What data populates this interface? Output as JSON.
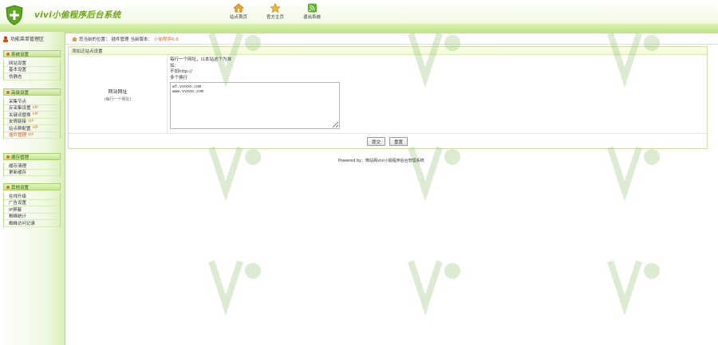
{
  "header": {
    "title": "vivi小偷程序后台系统",
    "nav": [
      {
        "label": "站点首页",
        "icon": "home-icon"
      },
      {
        "label": "官方主页",
        "icon": "star-icon"
      },
      {
        "label": "退出系统",
        "icon": "rss-icon"
      }
    ]
  },
  "sidebar": {
    "heading": "功能菜单管理区",
    "groups": [
      {
        "title": "系统设置",
        "items": [
          "网站设置",
          "基本设置",
          "伪静态"
        ]
      },
      {
        "title": "高级设置",
        "items": [
          "采集节点",
          "反采集设置",
          "关键词替换",
          "友情链接",
          "站点群配置",
          "插件管理"
        ]
      },
      {
        "title": "缓存管理",
        "items": [
          "缓存清理",
          "更新缓存"
        ]
      },
      {
        "title": "其他设置",
        "items": [
          "在线升级",
          "广告设置",
          "IP屏蔽",
          "蜘蛛统计",
          "蜘蛛访问记录"
        ]
      }
    ],
    "vip_badge": "VIP"
  },
  "breadcrumb": {
    "prefix": "您当前的位置：",
    "section": "插件管理",
    "label": "当前版本：",
    "version": "小偷程序6.6"
  },
  "panel": {
    "title": "添加泛站点设置",
    "field_label": "网站网址",
    "field_hint": "(每行一个网址)",
    "note_lines": [
      "每行一个网址，以本站这个为准",
      "如：",
      "不加http://",
      "多个换行"
    ],
    "domains_value": "wf.vvooo.com\nwww.vvooo.com"
  },
  "buttons": {
    "save": "提交",
    "reset": "重置"
  },
  "footer": "Powered by：微站阁vivi小偷程序后台管理系统"
}
